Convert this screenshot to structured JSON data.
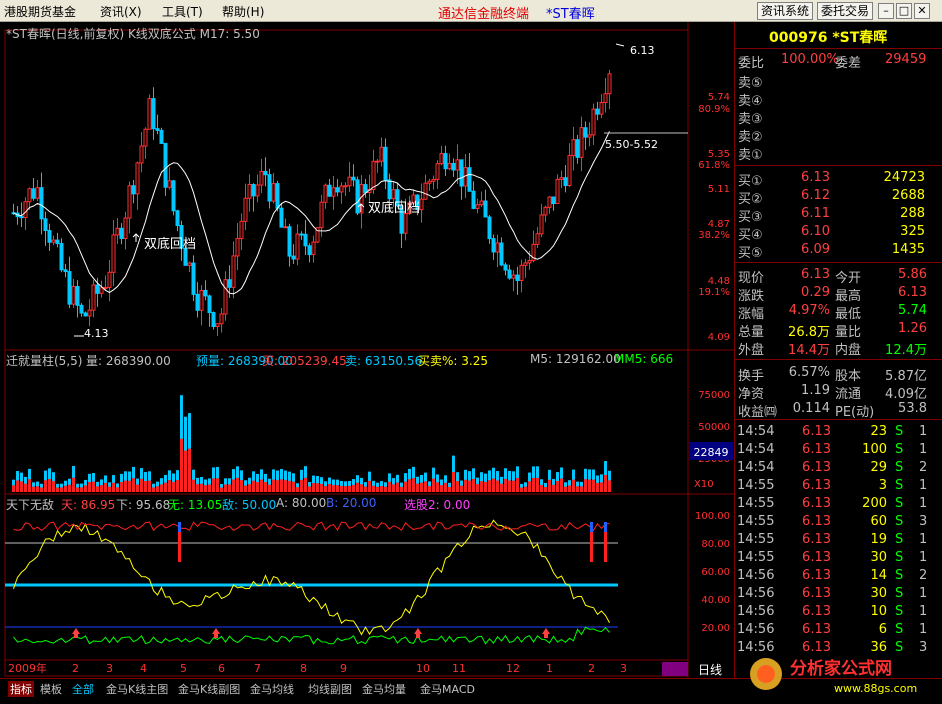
{
  "menu": {
    "items": [
      "港股期货基金",
      "资讯(X)",
      "工具(T)",
      "帮助(H)"
    ],
    "center_title": "通达信金融终端",
    "stock_title": "*ST春晖",
    "btn_info": "资讯系统",
    "btn_trade": "委托交易"
  },
  "kline": {
    "header": "*ST春晖(日线,前复权) K线双底公式  M17: 5.50",
    "price_labels": [
      "5.74",
      "80.9%",
      "5.35",
      "61.8%",
      "5.11",
      "4.87",
      "38.2%",
      "4.48",
      "19.1%",
      "4.09"
    ],
    "annotations": {
      "high": "6.13",
      "low": "4.13",
      "line_label": "5.50-5.52",
      "sig1": "双底回档",
      "sig2": "双底回档"
    }
  },
  "volume": {
    "header_name": "迁就量柱(5,5)",
    "header_vol": "量: 268390.00",
    "header_yuliang": "预量: 268390.00",
    "header_buy": "买: 205239.45",
    "header_sell": "卖: 63150.56",
    "header_ratio": "买卖%: 3.25",
    "header_m5": "M5: 129162.00",
    "header_mm5": "MM5: 666",
    "axis": [
      "75000",
      "50000",
      "25000"
    ],
    "current": "22849",
    "unit": "X10"
  },
  "indicator": {
    "name": "天下无敌",
    "tian": "天: 86.95",
    "xia": "下: 95.68",
    "wu": "无: 13.05",
    "di": "敌: 50.00",
    "a": "A: 80.00",
    "b": "B: 20.00",
    "xuangu": "选股2: 0.00",
    "axis": [
      "100.00",
      "80.00",
      "60.00",
      "40.00",
      "20.00"
    ]
  },
  "xaxis": {
    "labels": [
      "2009年",
      "2",
      "3",
      "4",
      "5",
      "6",
      "7",
      "8",
      "9",
      "10",
      "11",
      "12",
      "1",
      "2",
      "3"
    ],
    "period": "日线"
  },
  "quote": {
    "code": "000976 *ST春晖",
    "weibi_label": "委比",
    "weibi": "100.00%",
    "weicha_label": "委差",
    "weicha": "29459",
    "sells": [
      {
        "label": "卖⑤",
        "price": "",
        "vol": ""
      },
      {
        "label": "卖④",
        "price": "",
        "vol": ""
      },
      {
        "label": "卖③",
        "price": "",
        "vol": ""
      },
      {
        "label": "卖②",
        "price": "",
        "vol": ""
      },
      {
        "label": "卖①",
        "price": "",
        "vol": ""
      }
    ],
    "buys": [
      {
        "label": "买①",
        "price": "6.13",
        "vol": "24723"
      },
      {
        "label": "买②",
        "price": "6.12",
        "vol": "2688"
      },
      {
        "label": "买③",
        "price": "6.11",
        "vol": "288"
      },
      {
        "label": "买④",
        "price": "6.10",
        "vol": "325"
      },
      {
        "label": "买⑤",
        "price": "6.09",
        "vol": "1435"
      }
    ],
    "stats": [
      {
        "l1": "现价",
        "v1": "6.13",
        "l2": "今开",
        "v2": "5.86"
      },
      {
        "l1": "涨跌",
        "v1": "0.29",
        "l2": "最高",
        "v2": "6.13"
      },
      {
        "l1": "涨幅",
        "v1": "4.97%",
        "l2": "最低",
        "v2": "5.74"
      },
      {
        "l1": "总量",
        "v1": "26.8万",
        "l2": "量比",
        "v2": "1.26"
      },
      {
        "l1": "外盘",
        "v1": "14.4万",
        "l2": "内盘",
        "v2": "12.4万"
      }
    ],
    "stats2": [
      {
        "l1": "换手",
        "v1": "6.57%",
        "l2": "股本",
        "v2": "5.87亿"
      },
      {
        "l1": "净资",
        "v1": "1.19",
        "l2": "流通",
        "v2": "4.09亿"
      },
      {
        "l1": "收益㈣",
        "v1": "0.114",
        "l2": "PE(动)",
        "v2": "53.8"
      }
    ],
    "ticks": [
      {
        "t": "14:54",
        "p": "6.13",
        "v": "23",
        "s": "S",
        "n": "1"
      },
      {
        "t": "14:54",
        "p": "6.13",
        "v": "100",
        "s": "S",
        "n": "1"
      },
      {
        "t": "14:54",
        "p": "6.13",
        "v": "29",
        "s": "S",
        "n": "2"
      },
      {
        "t": "14:55",
        "p": "6.13",
        "v": "3",
        "s": "S",
        "n": "1"
      },
      {
        "t": "14:55",
        "p": "6.13",
        "v": "200",
        "s": "S",
        "n": "1"
      },
      {
        "t": "14:55",
        "p": "6.13",
        "v": "60",
        "s": "S",
        "n": "3"
      },
      {
        "t": "14:55",
        "p": "6.13",
        "v": "19",
        "s": "S",
        "n": "1"
      },
      {
        "t": "14:55",
        "p": "6.13",
        "v": "30",
        "s": "S",
        "n": "1"
      },
      {
        "t": "14:56",
        "p": "6.13",
        "v": "14",
        "s": "S",
        "n": "2"
      },
      {
        "t": "14:56",
        "p": "6.13",
        "v": "30",
        "s": "S",
        "n": "1"
      },
      {
        "t": "14:56",
        "p": "6.13",
        "v": "10",
        "s": "S",
        "n": "1"
      },
      {
        "t": "14:56",
        "p": "6.13",
        "v": "6",
        "s": "S",
        "n": "1"
      },
      {
        "t": "14:56",
        "p": "6.13",
        "v": "36",
        "s": "S",
        "n": "3"
      }
    ]
  },
  "bottom_tabs": [
    "指标",
    "模板",
    "全部",
    "金马K线主图",
    "金马K线副图",
    "金马均线",
    "均线副图",
    "金马均量",
    "金马MACD"
  ],
  "logo": {
    "text": "分析家公式网",
    "url": "www.88gs.com"
  }
}
